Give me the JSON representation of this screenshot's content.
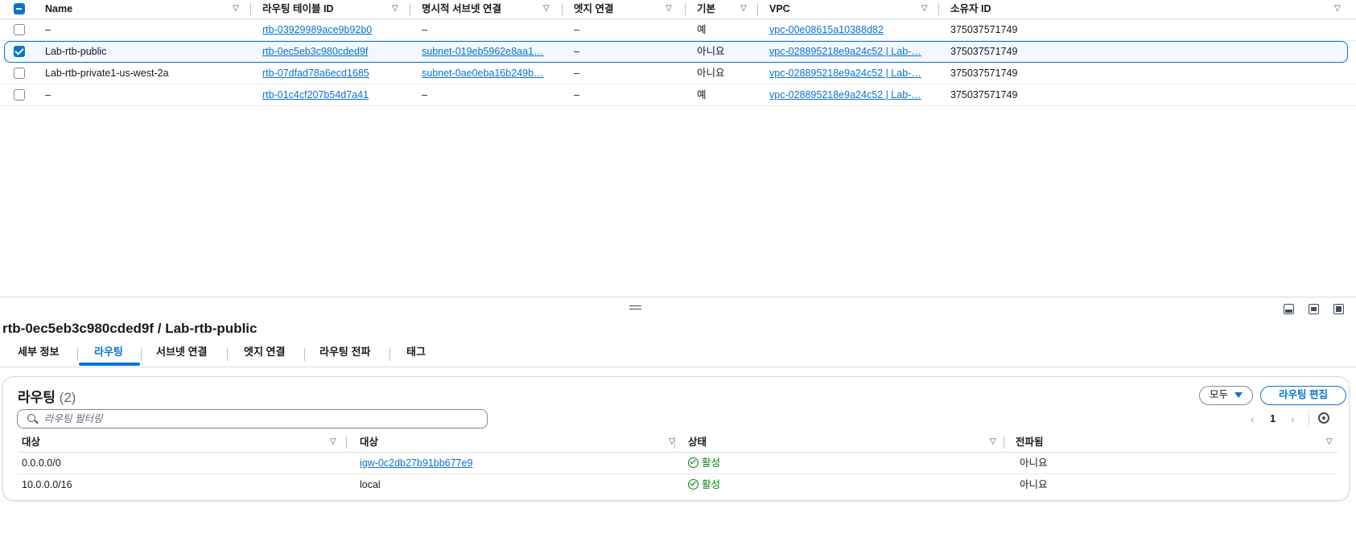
{
  "route_tables": {
    "columns": [
      "Name",
      "라우팅 테이블 ID",
      "명시적 서브넷 연결",
      "엣지 연결",
      "기본",
      "VPC",
      "소유자 ID"
    ],
    "rows": [
      {
        "name": "–",
        "id": "rtb-03929989ace9b92b0",
        "subnet": "–",
        "edge": "–",
        "main": "예",
        "vpc": "vpc-00e08615a10388d82",
        "owner": "375037571749",
        "selected": false
      },
      {
        "name": "Lab-rtb-public",
        "id": "rtb-0ec5eb3c980cded9f",
        "subnet": "subnet-019eb5962e8aa1…",
        "edge": "–",
        "main": "아니요",
        "vpc": "vpc-028895218e9a24c52 | Lab-…",
        "owner": "375037571749",
        "selected": true
      },
      {
        "name": "Lab-rtb-private1-us-west-2a",
        "id": "rtb-07dfad78a6ecd1685",
        "subnet": "subnet-0ae0eba16b249b…",
        "edge": "–",
        "main": "아니요",
        "vpc": "vpc-028895218e9a24c52 | Lab-…",
        "owner": "375037571749",
        "selected": false
      },
      {
        "name": "–",
        "id": "rtb-01c4cf207b54d7a41",
        "subnet": "–",
        "edge": "–",
        "main": "예",
        "vpc": "vpc-028895218e9a24c52 | Lab-…",
        "owner": "375037571749",
        "selected": false
      }
    ]
  },
  "detail": {
    "title": "rtb-0ec5eb3c980cded9f / Lab-rtb-public",
    "tabs": [
      "세부 정보",
      "라우팅",
      "서브넷 연결",
      "엣지 연결",
      "라우팅 전파",
      "태그"
    ],
    "active_tab": "라우팅"
  },
  "routes": {
    "heading": "라우팅",
    "count": "(2)",
    "filter_dropdown": "모두",
    "edit_button": "라우팅 편집",
    "search_placeholder": "라우팅 필터링",
    "page": "1",
    "columns": [
      "대상",
      "대상",
      "상태",
      "전파됨"
    ],
    "rows": [
      {
        "destination": "0.0.0.0/0",
        "target": "igw-0c2db27b91bb677e9",
        "target_is_link": true,
        "status": "활성",
        "propagated": "아니요"
      },
      {
        "destination": "10.0.0.0/16",
        "target": "local",
        "target_is_link": false,
        "status": "활성",
        "propagated": "아니요"
      }
    ]
  },
  "colors": {
    "accent": "#0972d3",
    "success": "#037f0c",
    "border": "#d5dbdb"
  },
  "icons": [
    "sort-caret-icon",
    "checkbox-icon",
    "drag-handle-icon",
    "panel-bottom-icon",
    "panel-side-icon",
    "panel-full-icon",
    "search-icon",
    "chevron-left-icon",
    "chevron-right-icon",
    "gear-icon",
    "status-ok-icon",
    "caret-down-icon"
  ]
}
